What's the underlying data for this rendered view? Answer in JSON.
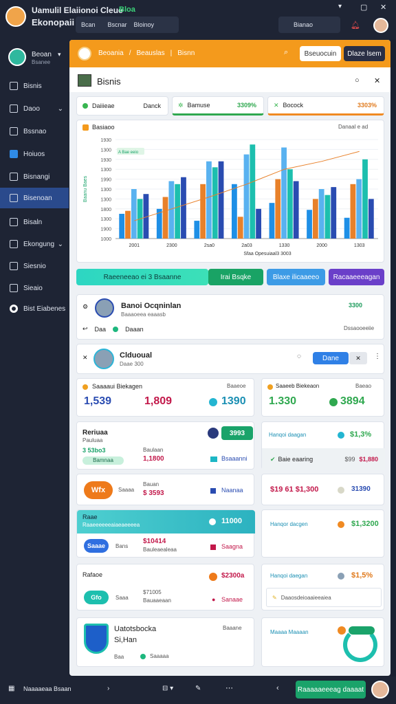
{
  "app": {
    "title": "Uamulil Elaiionoi Cleue",
    "title_tag": "Bloa",
    "subtitle": "Ekonopaii"
  },
  "topbar": {
    "btn1": "Bcan",
    "btn2": "Bscnar",
    "btn3": "Bloinoy",
    "search_label": "Bianao"
  },
  "sidebar": {
    "user_name": "Beoan",
    "user_sub": "Bsanee",
    "items": [
      {
        "label": "Bisnis"
      },
      {
        "label": "Daoo"
      },
      {
        "label": "Bssnao"
      },
      {
        "label": "Hoiuos"
      },
      {
        "label": "Bisnangi"
      },
      {
        "label": "Bisenoan"
      },
      {
        "label": "Bisaln"
      },
      {
        "label": "Ekongung"
      },
      {
        "label": "Siesnio"
      },
      {
        "label": "Sieaio"
      },
      {
        "label": "Bist Eiabenes"
      }
    ]
  },
  "header": {
    "crumb1": "Beoania",
    "crumb2": "Beauslas",
    "crumb3": "Bisnn",
    "btn_primary": "Bseuocuin",
    "btn_dark": "Dlaze lsem"
  },
  "page": {
    "title": "Bisnis"
  },
  "tabs": [
    {
      "label": "Daiiieae",
      "right": "Danck"
    },
    {
      "label": "Bamuse",
      "right": "3309%"
    },
    {
      "label": "Bocock",
      "right": "3303%"
    }
  ],
  "chart_data": {
    "type": "bar",
    "title": "Basiaoo",
    "legend_right": "Danaal e ad",
    "ylabel": "Baanu Baes",
    "ytick_labels": [
      "1930",
      "1300",
      "1930",
      "1300",
      "1990",
      "1300",
      "1300",
      "1800",
      "1300",
      "1900",
      "1000"
    ],
    "xtick_labels": [
      "2001",
      "2300",
      "2sa0",
      "2a03",
      "1330",
      "2000",
      "1303"
    ],
    "xlabel": "Sfaa  Opesuiaal3  3003",
    "annotation": "A Bae eeio",
    "ylim": [
      0,
      100
    ],
    "series": [
      {
        "color": "#1e8fe6",
        "values": [
          25,
          30,
          18,
          55,
          36,
          29,
          21
        ]
      },
      {
        "color": "#e8812a",
        "values": [
          28,
          42,
          55,
          22,
          60,
          40,
          55
        ]
      },
      {
        "color": "#59b2f0",
        "values": [
          50,
          58,
          78,
          85,
          92,
          50,
          60
        ]
      },
      {
        "color": "#1dbfae",
        "values": [
          40,
          55,
          72,
          95,
          70,
          44,
          80
        ]
      },
      {
        "color": "#2a4cb1",
        "values": [
          45,
          62,
          78,
          30,
          58,
          52,
          40
        ]
      }
    ],
    "trend": [
      18,
      30,
      42,
      55,
      70,
      78,
      88
    ]
  },
  "actions": {
    "teal": "Raeeneeao ei 3 Bsaanne",
    "green": "Irai Bsqke",
    "blue": "Blaxe ilicaaeeo",
    "purple": "Racaaeeeagan"
  },
  "profile1": {
    "name": "Banoi Ocqninlan",
    "sub": "Baaaoeea eaaasb",
    "meta": "Daa",
    "status": "Daaan",
    "tag": "3300",
    "right": "Dssaooeeiie"
  },
  "profile2": {
    "name": "Clduoual",
    "sub": "Daae 300",
    "btn": "Dane"
  },
  "stats": [
    {
      "title": "Saaaaui Biekagen",
      "tag": "Baaeoe",
      "v1": "1,539",
      "v2": "1,809",
      "v3": "1390"
    },
    {
      "title": "Saaeeb Biekeaon",
      "tag": "Baeao",
      "v1": "1.330",
      "v3": "3894"
    }
  ],
  "panels": {
    "p1": {
      "title": "Reriuaa",
      "sub": "Pauluaa",
      "badge": "3993",
      "tag1": "3 53bo3",
      "tag2": "Bamnaa",
      "tag3": "Bsaaanni",
      "v": "1,1800",
      "v_label": "Baulaan"
    },
    "p2": {
      "title": "Hanqoi daagan",
      "v": "$1,3%",
      "row": "Baie eaaring",
      "r1": "$99",
      "r2": "$1,880"
    },
    "p3": {
      "chip": "Wfx",
      "sub": "Saaaa",
      "v": "$ 3593",
      "label": "Bauan",
      "tag": "Naanaa"
    },
    "p4": {
      "title": "$19 61 $1,300",
      "right": "31390"
    },
    "p5": {
      "title": "Raae",
      "sub": "Raaeeeeeeaiaeaeeeea",
      "v": "11000",
      "chip": "Saaae",
      "label": "Bans",
      "v2": "$10414",
      "v2s": "Bauleaealeaa",
      "tag": "Saagna"
    },
    "p6": {
      "title": "Hanqor dacgen",
      "v": "$1,3200"
    },
    "p7": {
      "title": "Rafaoe",
      "v": "$2300a",
      "chip": "Gfo",
      "sub": "Saaa",
      "v2": "$71005",
      "v2s": "Bauaaeaan",
      "tag": "Sanaae"
    },
    "p8": {
      "title": "Hanqoi daegan",
      "v": "$1,5%",
      "row": "Daaosdeioaaieeaiea"
    },
    "p9": {
      "title": "Uatotsbocka",
      "sub": "Si,Han",
      "chip": "Baa",
      "tag": "Saaaaa",
      "right": "Baaane"
    },
    "p10": {
      "title": "Maaaa Maaaan"
    }
  },
  "footer": {
    "left": "Naaaaeaa Bsaan",
    "cta": "Raaaaaeeeag daaaat"
  }
}
